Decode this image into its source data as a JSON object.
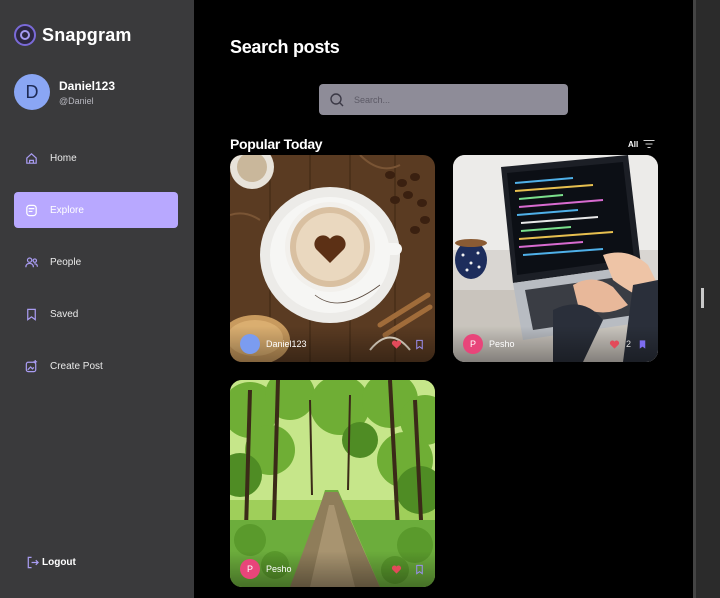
{
  "app": {
    "name": "Snapgram"
  },
  "profile": {
    "initial": "D",
    "name": "Daniel123",
    "handle": "@Daniel"
  },
  "sidebar": {
    "items": [
      {
        "label": "Home",
        "icon": "home-icon",
        "active": false
      },
      {
        "label": "Explore",
        "icon": "explore-icon",
        "active": true
      },
      {
        "label": "People",
        "icon": "people-icon",
        "active": false
      },
      {
        "label": "Saved",
        "icon": "bookmark-icon",
        "active": false
      },
      {
        "label": "Create Post",
        "icon": "create-post-icon",
        "active": false
      }
    ],
    "logout_label": "Logout"
  },
  "main": {
    "title": "Search posts",
    "search_placeholder": "Search...",
    "section_title": "Popular Today",
    "filter_label": "All"
  },
  "posts": [
    {
      "photo": "coffee",
      "user_initial": "",
      "user": "Daniel123",
      "avatar_color": "#7b9cf0",
      "likes": "",
      "liked": true,
      "saved": false
    },
    {
      "photo": "laptop",
      "user_initial": "P",
      "user": "Pesho",
      "avatar_color": "#e8457a",
      "likes": "2",
      "liked": true,
      "saved": true
    },
    {
      "photo": "forest",
      "user_initial": "P",
      "user": "Pesho",
      "avatar_color": "#e8457a",
      "likes": "",
      "liked": true,
      "saved": false
    }
  ],
  "colors": {
    "accent": "#b8a8ff",
    "sidebar_bg": "#3a3a3c",
    "like": "#e24a5a",
    "save": "#7d6cf0"
  }
}
